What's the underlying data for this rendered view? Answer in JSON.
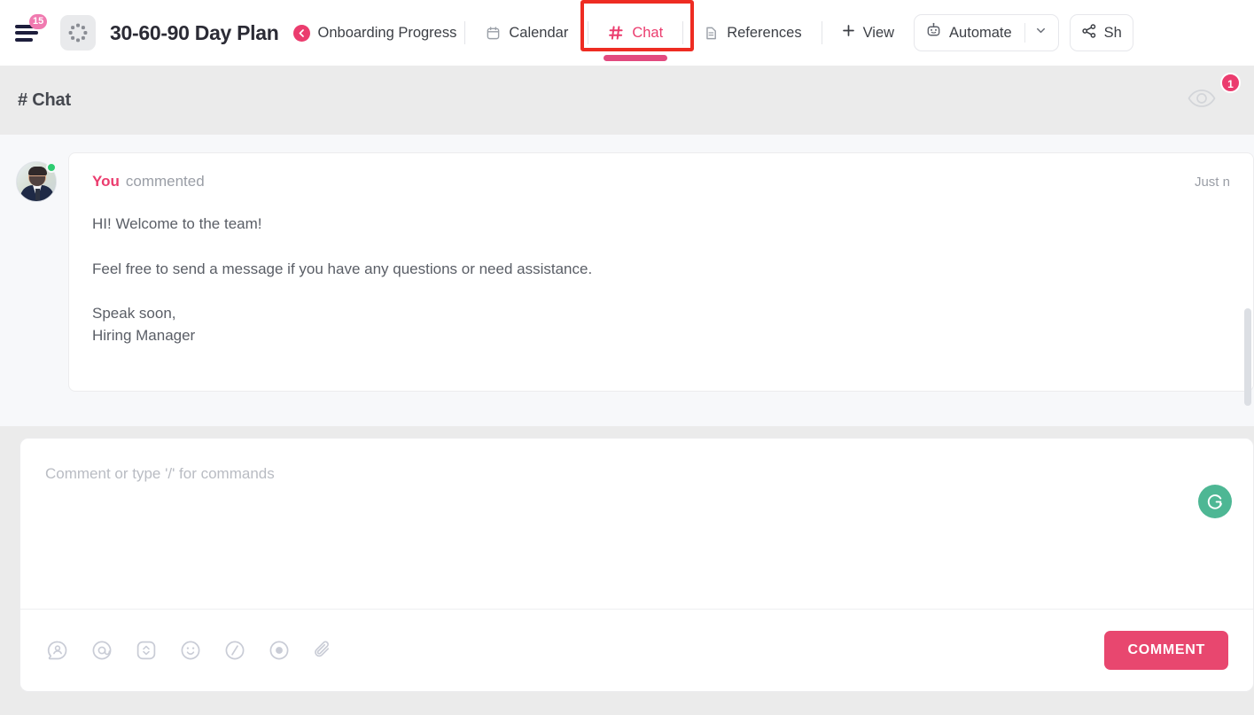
{
  "topbar": {
    "menu_badge": "15",
    "menu_icon": "hamburger-icon",
    "doc_icon": "loading-spinner-icon",
    "doc_title": "30-60-90 Day Plan",
    "breadcrumb_back_icon": "chevron-left-circle-icon",
    "breadcrumb_label": "Onboarding Progress",
    "tabs": [
      {
        "label": "Calendar",
        "icon": "calendar-icon",
        "active": false
      },
      {
        "label": "Chat",
        "icon": "hash-icon",
        "active": true
      },
      {
        "label": "References",
        "icon": "document-icon",
        "active": false
      }
    ],
    "view_label": "View",
    "view_icon": "plus-icon",
    "automate_label": "Automate",
    "automate_icon": "robot-icon",
    "automate_caret_icon": "chevron-down-icon",
    "share_label": "Sh",
    "share_icon": "share-icon"
  },
  "chat_header": {
    "title": "# Chat",
    "watcher_icon": "eye-icon",
    "watcher_count": "1"
  },
  "message": {
    "avatar": "user-avatar-photo",
    "status": "online",
    "author": "You",
    "verb": "commented",
    "time": "Just n",
    "lines": [
      "HI! Welcome to the team!",
      "Feel free to send a message if you have any questions or need assistance.",
      "Speak soon,",
      "Hiring Manager"
    ]
  },
  "composer": {
    "placeholder": "Comment or type '/' for commands",
    "grammarly_icon": "grammarly-icon",
    "tools": [
      {
        "name": "assign-comment-icon"
      },
      {
        "name": "mention-icon"
      },
      {
        "name": "expand-icon"
      },
      {
        "name": "emoji-icon"
      },
      {
        "name": "slash-command-icon"
      },
      {
        "name": "record-icon"
      },
      {
        "name": "attachment-icon"
      }
    ],
    "submit_label": "COMMENT"
  },
  "colors": {
    "accent_pink": "#eb3c6e",
    "button_pink": "#e8476f",
    "annotation_red": "#ee2c22",
    "online_green": "#2ecc71",
    "grammarly_green": "#4eb794"
  }
}
